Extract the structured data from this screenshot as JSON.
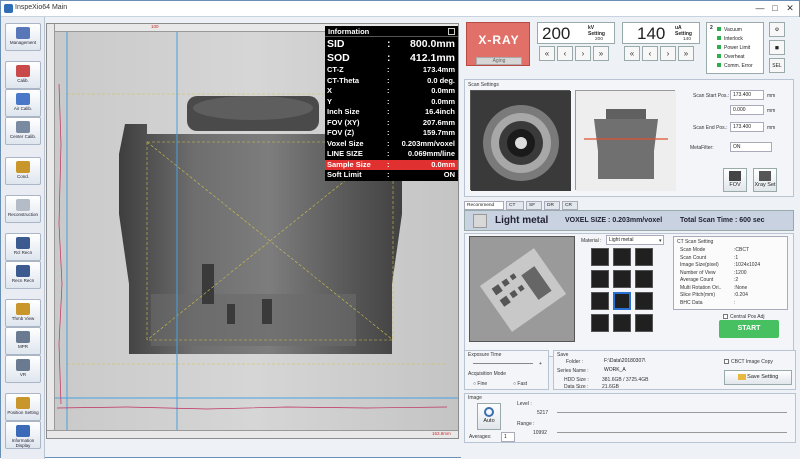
{
  "window": {
    "title": "InspeXio64 Main",
    "controls": [
      "—",
      "□",
      "✕"
    ]
  },
  "left_toolbar": [
    {
      "label": "Management",
      "icon": "management-icon",
      "color": "#5877b8"
    },
    {
      "label": "Calib.",
      "icon": "calib-icon",
      "color": "#c84a4a"
    },
    {
      "label": "Air Calib.",
      "icon": "air-calib-icon",
      "color": "#4a78c8"
    },
    {
      "label": "Center Calib.",
      "icon": "center-calib-icon",
      "color": "#7a8aa0"
    },
    {
      "label": "Cond.",
      "icon": "condition-icon",
      "color": "#c8962a"
    },
    {
      "label": "Reconstruction",
      "icon": "reconstruction-icon",
      "color": "#b4bcc8"
    },
    {
      "label": "Rcl Recn",
      "icon": "rcl-recon-icon",
      "color": "#3a5a90"
    },
    {
      "label": "Recn Recn",
      "icon": "recn-recon-icon",
      "color": "#3a5a90"
    },
    {
      "label": "Thmb View",
      "icon": "thumb-view-icon",
      "color": "#c8962a"
    },
    {
      "label": "MPR",
      "icon": "mpr-icon",
      "color": "#6a7a90"
    },
    {
      "label": "VR",
      "icon": "vr-icon",
      "color": "#6a7a90"
    },
    {
      "label": "Position Setting",
      "icon": "position-setting-icon",
      "color": "#c8962a"
    },
    {
      "label": "Information Display",
      "icon": "information-display-icon",
      "color": "#3a6ab8"
    }
  ],
  "viewer": {
    "ruler_top": "100",
    "ruler_bottom": "163.8mm"
  },
  "info": {
    "header": "Information",
    "rows": [
      {
        "k": "SID",
        "v": "800.0mm",
        "big": true
      },
      {
        "k": "SOD",
        "v": "412.1mm",
        "big": true
      },
      {
        "k": "CT-Z",
        "v": "173.4mm"
      },
      {
        "k": "CT-Theta",
        "v": "0.0 deg."
      },
      {
        "k": "X",
        "v": "0.0mm"
      },
      {
        "k": "Y",
        "v": "0.0mm"
      },
      {
        "k": "Inch Size",
        "v": "16.4inch"
      },
      {
        "k": "FOV (XY)",
        "v": "207.6mm"
      },
      {
        "k": "FOV (Z)",
        "v": "159.7mm"
      },
      {
        "k": "Voxel Size",
        "v": "0.203mm/voxel"
      },
      {
        "k": "LINE SIZE",
        "v": "0.069mm/line"
      },
      {
        "k": "Sample Size",
        "v": "0.0mm",
        "red": true
      },
      {
        "k": "Soft Limit",
        "v": "ON"
      }
    ]
  },
  "xray": {
    "label": "X-RAY",
    "aging": "Aging"
  },
  "kv": {
    "value": "200",
    "unit": "kV",
    "setting_label": "Setting",
    "setting": "200"
  },
  "ua": {
    "value": "140",
    "unit": "uA",
    "setting_label": "Setting",
    "setting": "140"
  },
  "arrows": [
    "«",
    "‹",
    "›",
    "»"
  ],
  "status": {
    "num": "2",
    "items": [
      "Vacuum",
      "Interlock",
      "Power Limit",
      "Overheat",
      "Comm. Error"
    ]
  },
  "side_buttons": [
    "⚙",
    "◼",
    "SEL"
  ],
  "scan": {
    "title": "Scan Settings",
    "start_label": "Scan Start Pos.:",
    "start_val": "173.400",
    "mm": "mm",
    "mid_val": "0.000",
    "end_label": "Scan End Pos.:",
    "end_val": "173.400",
    "metafilter_label": "MetaFilter:",
    "metafilter_val": "ON",
    "fov_btn": "FOV",
    "xray_set_btn": "Xray Set"
  },
  "tabs": [
    "Recommend",
    "CT",
    "SF",
    "DR",
    "CR"
  ],
  "band": {
    "material": "Light metal",
    "voxel": "VOXEL SIZE : 0.203mm/voxel",
    "time": "Total Scan Time : 600 sec"
  },
  "material": {
    "label": "Material :",
    "value": "Light metal"
  },
  "ct_scan": {
    "title": "CT Scan Setting",
    "rows": [
      [
        "Scan Mode",
        ":CBCT"
      ],
      [
        "Scan Count",
        ":1"
      ],
      [
        "Image Size(pixel)",
        ":1024x1024"
      ],
      [
        "Number of View",
        ":1200"
      ],
      [
        "Average Count",
        ":2"
      ],
      [
        "Multi Rotation Ori..",
        ":None"
      ],
      [
        "Slice Pitch(mm)",
        ":0.204"
      ],
      [
        "BHC Data",
        ":"
      ]
    ]
  },
  "central_pos": "Central Pos Adj",
  "start_btn": "START",
  "exposure": {
    "title": "Exposure Time",
    "acq_title": "Acquisition Mode",
    "fine": "Fine",
    "fast": "Fast",
    "mark": "+"
  },
  "save": {
    "title": "Save",
    "folder_label": "Folder :",
    "folder": "F:\\Data\\20180307\\",
    "series_label": "Series Name :",
    "series": "WORK_A",
    "hdd_label": "HDD Size :",
    "hdd": "381.6GB / 3725.4GB",
    "data_label": "Data Size :",
    "data": "21.6GB",
    "cbct_copy": "CBCT Image Copy",
    "save_btn": "Save Setting"
  },
  "image": {
    "title": "Image",
    "auto": "Auto",
    "level_label": "Level :",
    "level": "5217",
    "range_label": "Range :",
    "range": "10992",
    "avg_label": "Averages:",
    "avg": "1"
  }
}
